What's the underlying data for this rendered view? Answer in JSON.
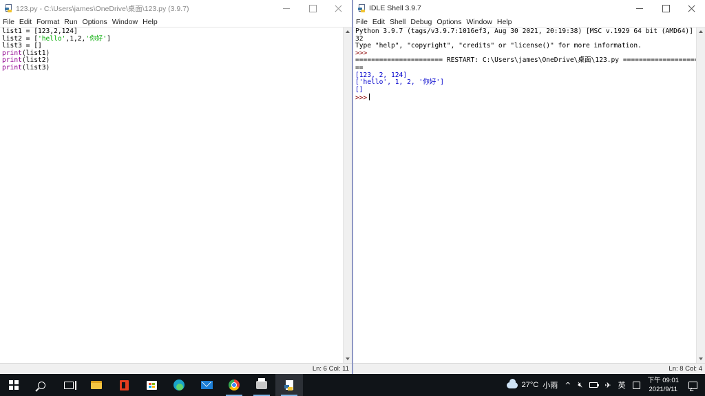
{
  "editor": {
    "title": "123.py - C:\\Users\\james\\OneDrive\\桌面\\123.py (3.9.7)",
    "menu": [
      "File",
      "Edit",
      "Format",
      "Run",
      "Options",
      "Window",
      "Help"
    ],
    "lines": {
      "l1": "list1 = [123,2,124]",
      "l2_pre": "list2 = [",
      "l2_s1": "'hello'",
      "l2_mid": ",1,2,",
      "l2_s2": "'你好'",
      "l2_post": "]",
      "l3": "list3 = []",
      "l4_fn": "print",
      "l4_arg": "(list1)",
      "l5_fn": "print",
      "l5_arg": "(list2)",
      "l6_fn": "print",
      "l6_arg": "(list3)"
    },
    "status": "Ln: 6   Col: 11"
  },
  "shell": {
    "title": "IDLE Shell 3.9.7",
    "menu": [
      "File",
      "Edit",
      "Shell",
      "Debug",
      "Options",
      "Window",
      "Help"
    ],
    "lines": {
      "banner1": "Python 3.9.7 (tags/v3.9.7:1016ef3, Aug 30 2021, 20:19:38) [MSC v.1929 64 bit (AMD64)] on win",
      "banner2": "32",
      "banner3": "Type \"help\", \"copyright\", \"credits\" or \"license()\" for more information.",
      "prompt1": ">>>",
      "restart1": "====================== RESTART: C:\\Users\\james\\OneDrive\\桌面\\123.py ======================",
      "restart2": "==",
      "out1": "[123, 2, 124]",
      "out2": "['hello', 1, 2, '你好']",
      "out3": "[]",
      "prompt2": ">>>"
    },
    "status": "Ln: 8   Col: 4"
  },
  "taskbar": {
    "apps": [
      "windows-start",
      "search",
      "task-view",
      "file-explorer",
      "office",
      "microsoft-store",
      "edge",
      "mail",
      "chrome",
      "printer-app",
      "idle-python"
    ],
    "weather_temp": "27°C",
    "weather_desc": "小雨",
    "chevron": "^",
    "ime": "英",
    "clock_time": "下午 09:01",
    "clock_date": "2021/9/11"
  }
}
